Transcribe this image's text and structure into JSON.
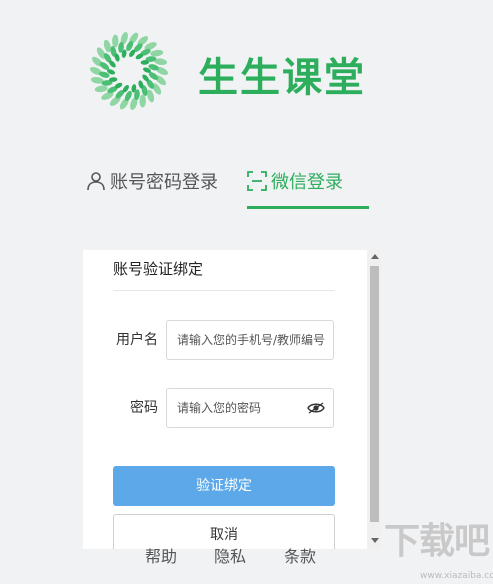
{
  "brand": {
    "name": "生生课堂",
    "color": "#2dae5c"
  },
  "tabs": [
    {
      "label": "账号密码登录",
      "icon": "user-icon",
      "active": false
    },
    {
      "label": "微信登录",
      "icon": "scan-icon",
      "active": true
    }
  ],
  "bind_panel": {
    "title": "账号验证绑定",
    "username": {
      "label": "用户名",
      "placeholder": "请输入您的手机号/教师编号",
      "value": ""
    },
    "password": {
      "label": "密码",
      "placeholder": "请输入您的密码",
      "value": "",
      "toggle_icon": "eye-icon"
    },
    "confirm_label": "验证绑定",
    "cancel_label": "取消"
  },
  "footer": {
    "help": "帮助",
    "privacy": "隐私",
    "terms": "条款"
  },
  "watermark": {
    "text": "下载吧",
    "url": "www.xiazaiba.com"
  },
  "colors": {
    "accent": "#2dae5c",
    "primary_button": "#5ca8e8",
    "background": "#f1f2f4"
  }
}
